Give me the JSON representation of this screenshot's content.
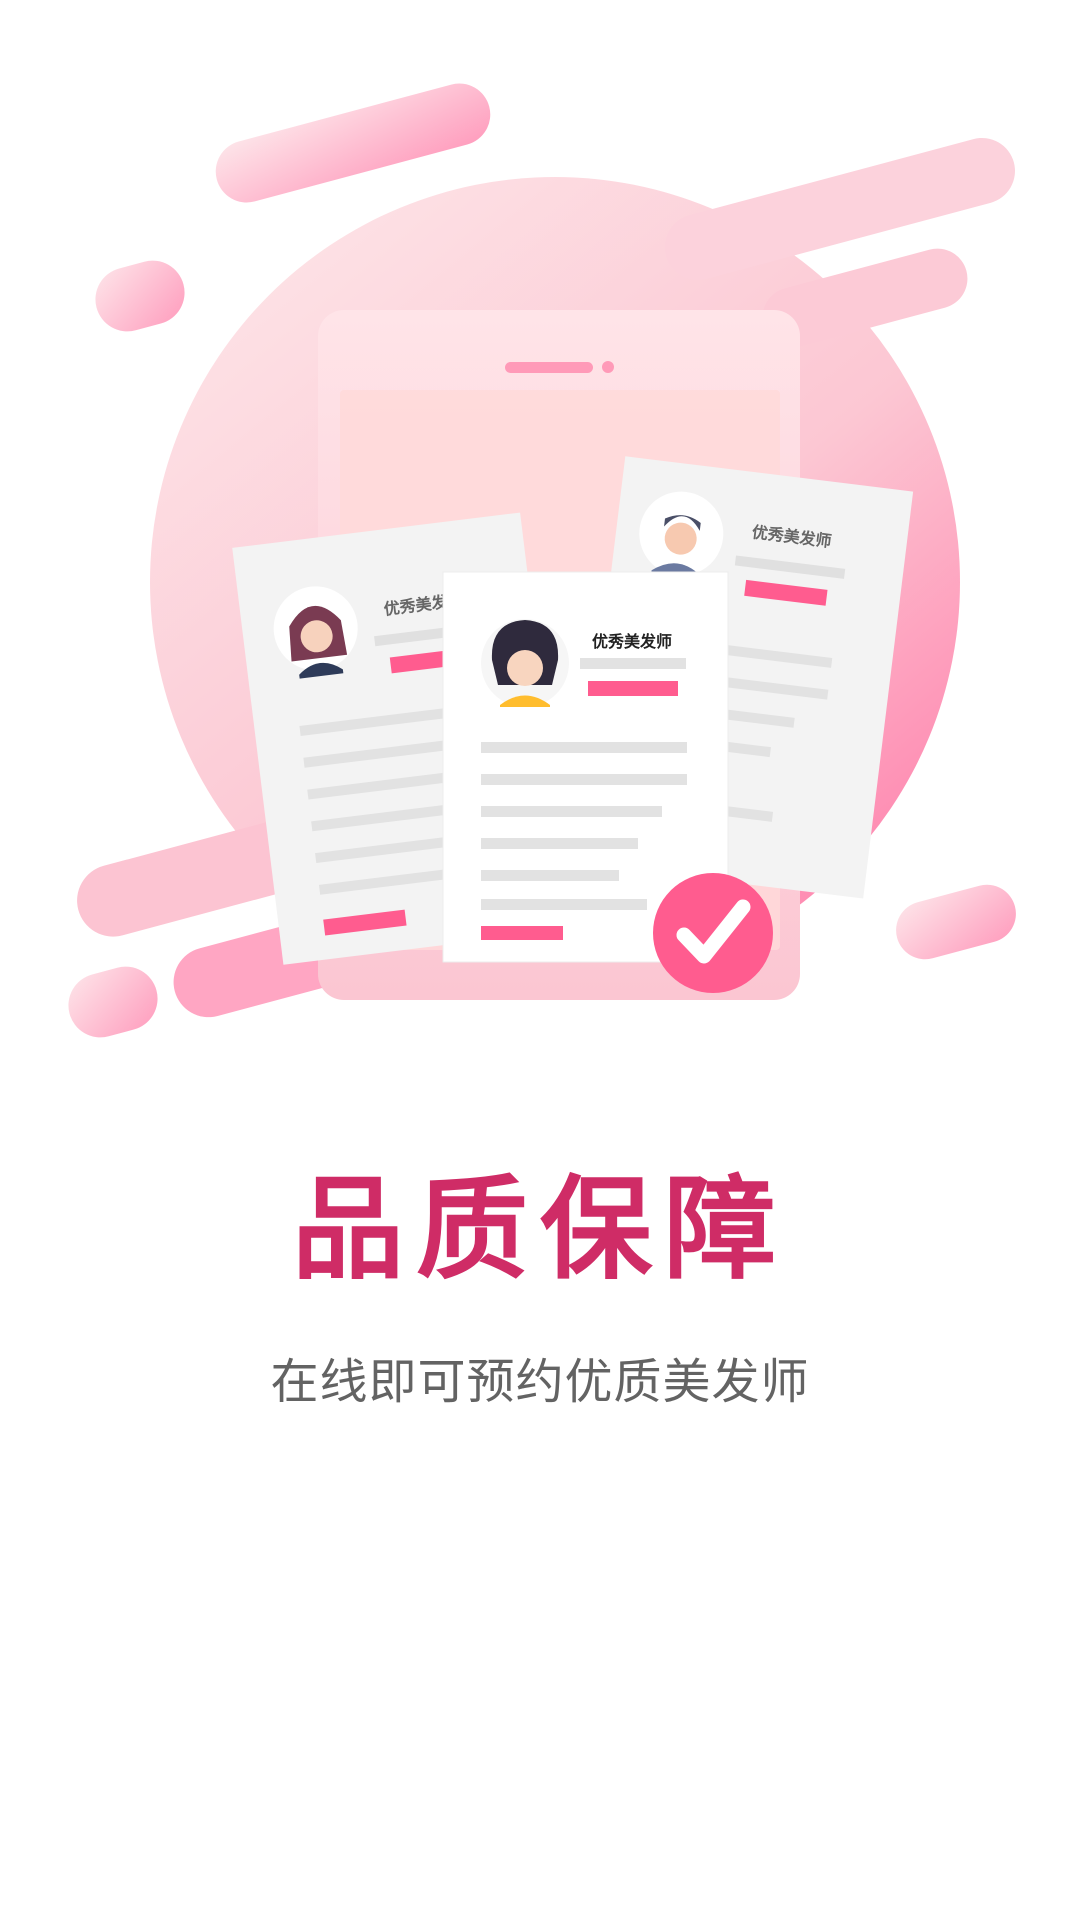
{
  "onboarding": {
    "title": "品质保障",
    "subtitle": "在线即可预约优质美发师"
  },
  "illustration": {
    "card_label": "优秀美发师",
    "icon": "check-icon",
    "colors": {
      "accent": "#ff5c8f",
      "title": "#cf2c66",
      "blob_light": "#fde0e4",
      "blob_dark": "#ff8ab3",
      "card": "#f4f4f4",
      "card_line": "#e3e3e3"
    }
  }
}
